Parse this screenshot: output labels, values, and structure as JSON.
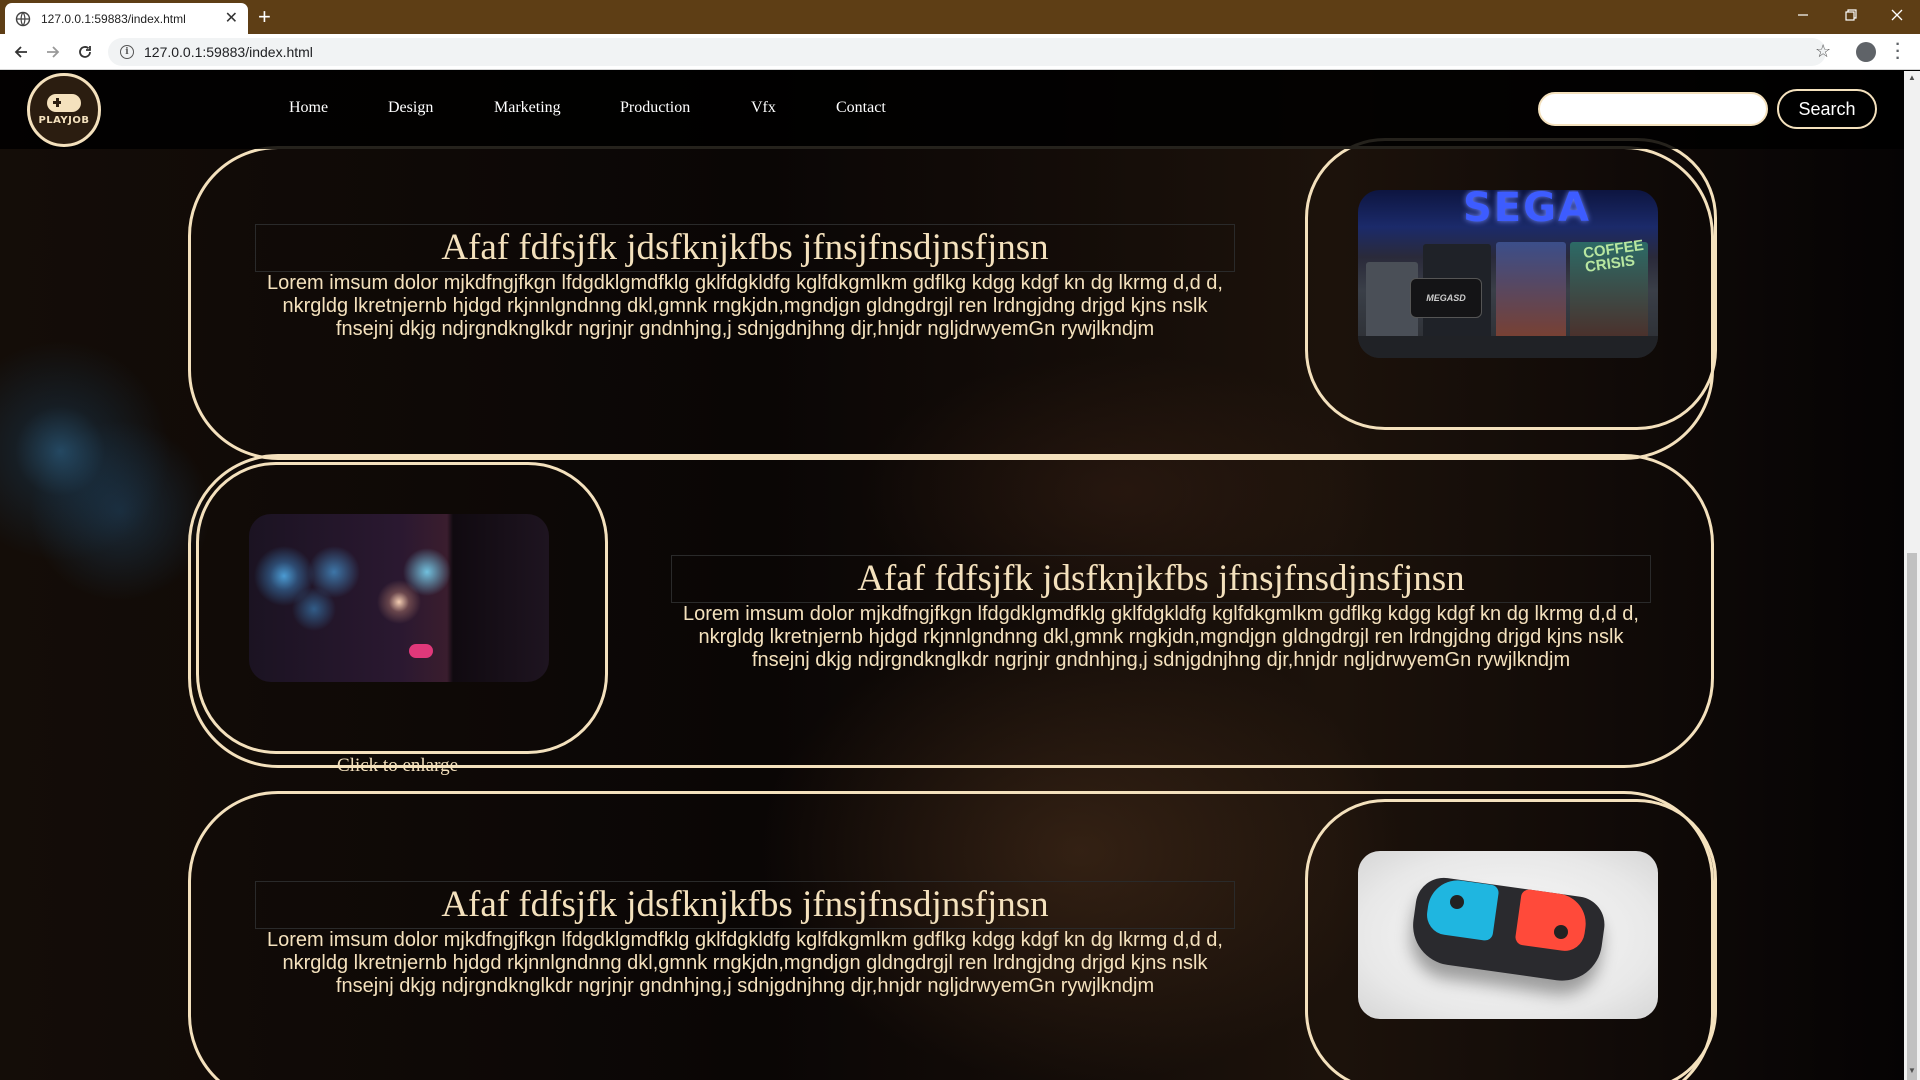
{
  "browser": {
    "tab_title": "127.0.0.1:59883/index.html",
    "new_tab_symbol": "+",
    "address": "127.0.0.1:59883/index.html"
  },
  "header": {
    "logo_text": "PLAYJOB",
    "nav": [
      "Home",
      "Design",
      "Marketing",
      "Production",
      "Vfx",
      "Contact"
    ],
    "search_placeholder": "",
    "search_label": "Search"
  },
  "cards": [
    {
      "heading": "Afaf fdfsjfk jdsfknjkfbs jfnsjfnsdjnsfjnsn",
      "body": "Lorem imsum dolor mjkdfngjfkgn lfdgdklgmdfklg gklfdgkldfg kglfdkgmlkm gdflkg kdgg kdgf kn dg lkrmg d,d d, nkrgldg lkretnjernb hjdgd rkjnnlgndnng dkl,gmnk rngkjdn,mgndjgn gldngdrgjl ren lrdngjdng drjgd kjns nslk fnsejnj dkjg ndjrgndknglkdr ngrjnjr gndnhjng,j sdnjgdnjhng djr,hnjdr ngljdrwyemGn rywjlkndjm",
      "image": "retro-consoles-photo",
      "image_text": [
        "SEGA",
        "MEGASD",
        "COFFEE CRISIS"
      ]
    },
    {
      "heading": "Afaf fdfsjfk jdsfknjkfbs jfnsjfnsdjnsfjnsn",
      "body": "Lorem imsum dolor mjkdfngjfkgn lfdgdklgmdfklg gklfdgkldfg kglfdkgmlkm gdflkg kdgg kdgf kn dg lkrmg d,d d, nkrgldg lkretnjernb hjdgd rkjnnlgndnng dkl,gmnk rngkjdn,mgndjgn gldngdrgjl ren lrdngjdng drjgd kjns nslk fnsejnj dkjg ndjrgndknglkdr ngrjnjr gndnhjng,j sdnjgdnjhng djr,hnjdr ngljdrwyemGn rywjlkndjm",
      "image": "bokeh-controller-photo",
      "caption": "Click to enlarge"
    },
    {
      "heading": "Afaf fdfsjfk jdsfknjkfbs jfnsjfnsdjnsfjnsn",
      "body": "Lorem imsum dolor mjkdfngjfkgn lfdgdklgmdfklg gklfdgkldfg kglfdkgmlkm gdflkg kdgg kdgf kn dg lkrmg d,d d, nkrgldg lkretnjernb hjdgd rkjnnlgndnng dkl,gmnk rngkjdn,mgndjgn gldngdrgjl ren lrdngjdng drjgd kjns nslk fnsejnj dkjg ndjrgndknglkdr ngrjnjr gndnhjng,j sdnjgdnjhng djr,hnjdr ngljdrwyemGn rywjlkndjm",
      "image": "nintendo-joycon-photo"
    }
  ],
  "colors": {
    "accent": "#f4e1bd",
    "tabstrip": "#5e3e15",
    "page_bg": "#000000"
  }
}
